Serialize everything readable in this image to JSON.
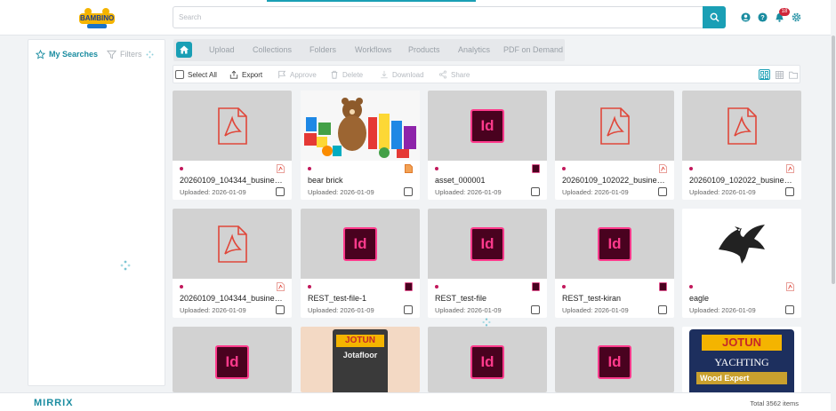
{
  "header": {
    "logo_text": "BAMBINO",
    "search_placeholder": "Search",
    "notification_count": "18"
  },
  "left_panel": {
    "tabs": [
      "My Searches",
      "Filters"
    ]
  },
  "nav": {
    "tabs": [
      "Upload",
      "Collections",
      "Folders",
      "Workflows",
      "Products",
      "Analytics",
      "PDF on Demand"
    ]
  },
  "toolbar": {
    "select_all": "Select All",
    "export": "Export",
    "approve": "Approve",
    "delete": "Delete",
    "download": "Download",
    "share": "Share"
  },
  "assets": [
    {
      "title": "20260109_104344_business...",
      "date": "Uploaded: 2026-01-09",
      "type": "pdf",
      "thumb": "pdf"
    },
    {
      "title": "bear brick",
      "date": "Uploaded: 2026-01-09",
      "type": "image",
      "thumb": "toys"
    },
    {
      "title": "asset_000001",
      "date": "Uploaded: 2026-01-09",
      "type": "indd",
      "thumb": "indd"
    },
    {
      "title": "20260109_102022_business...",
      "date": "Uploaded: 2026-01-09",
      "type": "pdf",
      "thumb": "pdf"
    },
    {
      "title": "20260109_102022_business...",
      "date": "Uploaded: 2026-01-09",
      "type": "pdf",
      "thumb": "pdf"
    },
    {
      "title": "20260109_104344_business...",
      "date": "Uploaded: 2026-01-09",
      "type": "pdf",
      "thumb": "pdf"
    },
    {
      "title": "REST_test-file-1",
      "date": "Uploaded: 2026-01-09",
      "type": "indd",
      "thumb": "indd"
    },
    {
      "title": "REST_test-file",
      "date": "Uploaded: 2026-01-09",
      "type": "indd",
      "thumb": "indd"
    },
    {
      "title": "REST_test-kiran",
      "date": "Uploaded: 2026-01-09",
      "type": "indd",
      "thumb": "indd"
    },
    {
      "title": "eagle",
      "date": "Uploaded: 2026-01-09",
      "type": "pdf",
      "thumb": "eagle"
    }
  ],
  "partial_row": [
    {
      "thumb": "indd"
    },
    {
      "thumb": "jotun-jotafloor",
      "label_main": "JOTUN",
      "label_sub": "Jotafloor"
    },
    {
      "thumb": "indd"
    },
    {
      "thumb": "indd"
    },
    {
      "thumb": "jotun-yachting",
      "label_main": "JOTUN",
      "label_sub": "YACHTING",
      "label_sub2": "Wood Expert"
    }
  ],
  "indd_label": "Id",
  "footer": {
    "logo": "MIRRIX",
    "total": "Total 3562 items"
  },
  "colors": {
    "accent": "#1a9fb5",
    "indd_bg": "#49021f",
    "indd_fg": "#ff3a8c",
    "pdf_red": "#e0473a",
    "badge": "#d0263a"
  }
}
